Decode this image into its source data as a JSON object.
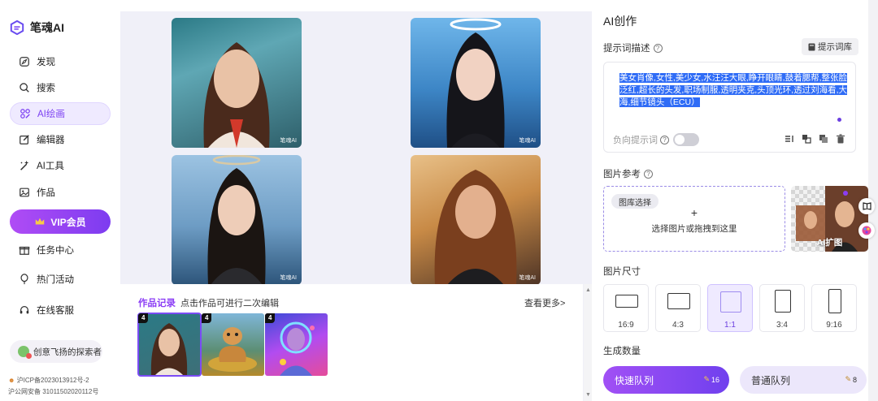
{
  "app": {
    "name": "笔魂AI",
    "brand_color": "#7b3ff2"
  },
  "sidebar": {
    "items": [
      {
        "label": "发现",
        "icon": "compass-icon"
      },
      {
        "label": "搜索",
        "icon": "search-icon"
      },
      {
        "label": "AI绘画",
        "icon": "paint-icon",
        "active": true
      },
      {
        "label": "编辑器",
        "icon": "edit-icon"
      },
      {
        "label": "AI工具",
        "icon": "magic-wand-icon"
      },
      {
        "label": "作品",
        "icon": "image-icon"
      },
      {
        "label": "任务中心",
        "icon": "gift-icon"
      },
      {
        "label": "热门活动",
        "icon": "balloon-icon"
      },
      {
        "label": "在线客服",
        "icon": "headset-icon"
      }
    ],
    "vip_label": "VIP会员",
    "user_name": "创意飞扬的探索者",
    "icp": "沪ICP备2023013912号-2",
    "police": "沪公网安备 31011502020112号"
  },
  "gallery": {
    "watermark": "笔魂AI"
  },
  "history": {
    "title": "作品记录",
    "subtitle": "点击作品可进行二次编辑",
    "more": "查看更多>",
    "thumbs": [
      {
        "count": "4"
      },
      {
        "count": "4"
      },
      {
        "count": "4"
      }
    ]
  },
  "panel": {
    "title": "AI创作",
    "prompt_label": "提示词描述",
    "prompt_library": "提示词库",
    "prompt_text": "美女肖像,女性,美少女,水汪汪大眼,睁开眼睛,鼓着腮帮,整张脸泛红,超长的头发,职场制服,透明夹克,头顶光环,透过刘海看,大海,细节镜头（ECU）",
    "negative_label": "负向提示词",
    "ref_label": "图片参考",
    "gallery_select": "图库选择",
    "upload_plus": "+",
    "upload_hint": "选择图片或拖拽到这里",
    "ai_expand": "AI扩图",
    "size_label": "图片尺寸",
    "sizes": [
      {
        "label": "16:9"
      },
      {
        "label": "4:3"
      },
      {
        "label": "1:1",
        "active": true
      },
      {
        "label": "3:4"
      },
      {
        "label": "9:16"
      }
    ],
    "count_label": "生成数量",
    "fast_queue": "快速队列",
    "fast_count": "16",
    "normal_queue": "普通队列",
    "normal_count": "8"
  }
}
